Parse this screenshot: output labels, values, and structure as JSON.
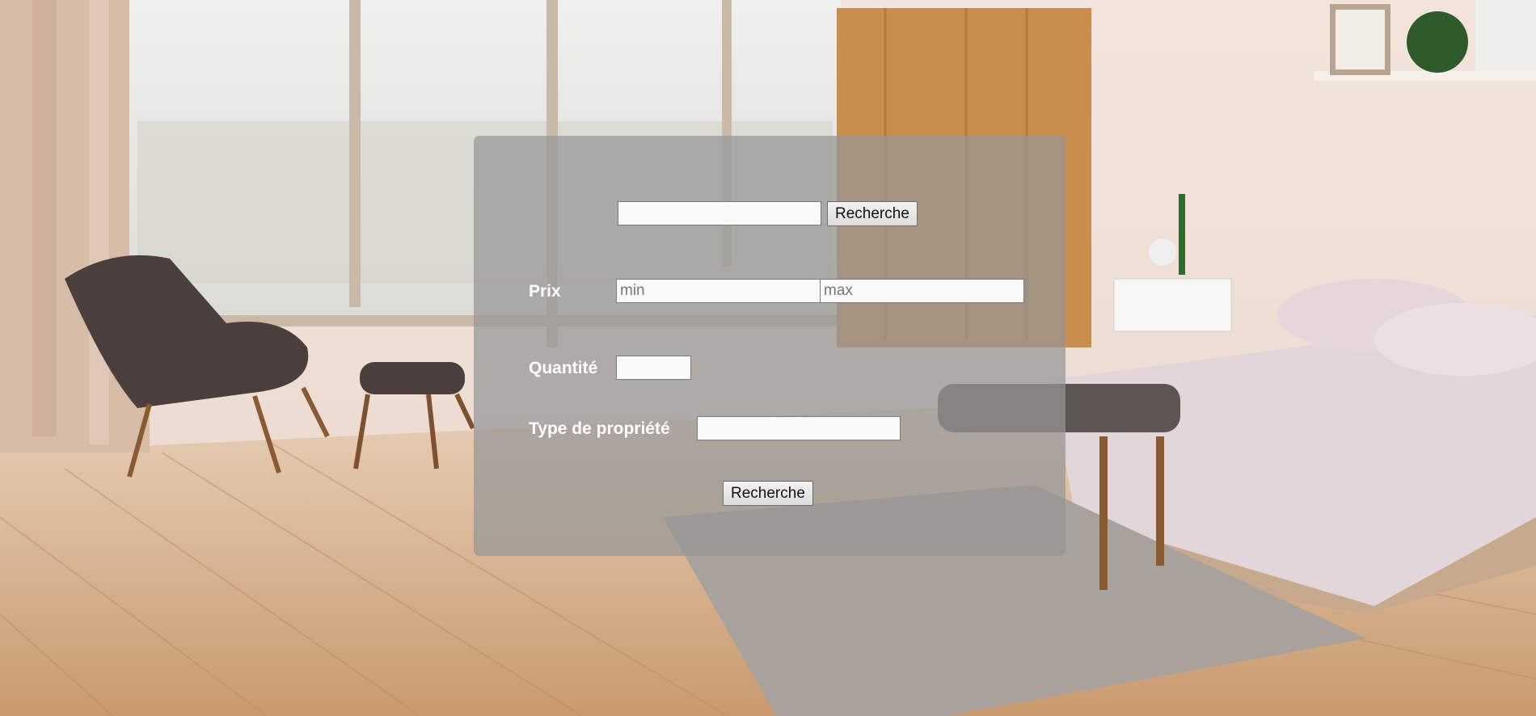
{
  "background": {
    "description_icon": "bedroom-photo"
  },
  "search": {
    "placeholder": "",
    "button_label": "Recherche"
  },
  "filters": {
    "price_label": "Prix",
    "price_min_placeholder": "min",
    "price_max_placeholder": "max",
    "quantity_label": "Quantité",
    "property_type_label": "Type de propriété",
    "submit_label": "Recherche"
  },
  "colors": {
    "panel": "#969696",
    "label": "#ffffff"
  }
}
